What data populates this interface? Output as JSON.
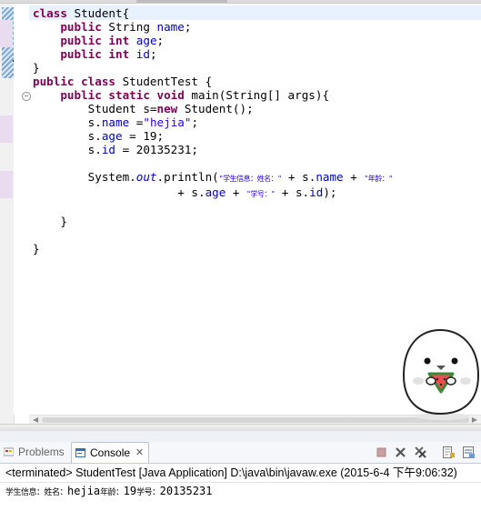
{
  "code": {
    "l1_kw": "class",
    "l1_rest": " Student{",
    "l2_kw": "public",
    "l2_type": " String ",
    "l2_field": "name",
    "l2_end": ";",
    "l3_kw": "public",
    "l3_kw2": " int",
    "l3_sp": " ",
    "l3_field": "age",
    "l3_end": ";",
    "l4_kw": "public",
    "l4_kw2": " int",
    "l4_sp": " ",
    "l4_field": "id",
    "l4_end": ";",
    "l5": "}",
    "l6_kw": "public class",
    "l6_rest": " StudentTest {",
    "l7_kw": "public static void",
    "l7_rest": " main(String[] args){",
    "l8_a": "Student s=",
    "l8_kw": "new",
    "l8_b": " Student();",
    "l9_a": "s.",
    "l9_field": "name",
    "l9_b": " =",
    "l9_str": "\"hejia\"",
    "l9_c": ";",
    "l10_a": "s.",
    "l10_field": "age",
    "l10_b": " = 19;",
    "l11_a": "s.",
    "l11_field": "id",
    "l11_b": " = 20135231;",
    "l13_a": "System.",
    "l13_out": "out",
    "l13_b": ".println(",
    "l13_s1": "\"学生信息：姓名：\"",
    "l13_c": " + s.",
    "l13_f1": "name",
    "l13_d": " + ",
    "l13_s2": "\"年龄：\"",
    "l14_a": " + s.",
    "l14_f1": "age",
    "l14_b": " + ",
    "l14_s1": "\"学号：\"",
    "l14_c": " + s.",
    "l14_f2": "id",
    "l14_d": ");",
    "l16": "}",
    "l18": "}"
  },
  "console": {
    "tab_problems": "Problems",
    "tab_console": "Console",
    "tab_close": "✕",
    "header": "<terminated> StudentTest [Java Application] D:\\java\\bin\\javaw.exe (2015-6-4 下午9:06:32)",
    "output_label1": "学生信息：姓名：",
    "output_name": "hejia",
    "output_label2": "年龄：",
    "output_age": "19",
    "output_label3": "学号：",
    "output_id": "20135231"
  },
  "icons": {
    "problems": "problems-icon",
    "console": "console-icon",
    "terminate": "terminate-icon",
    "remove_launch": "remove-launch-icon",
    "remove_all": "remove-all-terminated-icon",
    "scroll_lock": "scroll-lock-icon",
    "word_wrap": "word-wrap-icon"
  },
  "colors": {
    "keyword": "#7f0055",
    "field": "#0000c0",
    "string": "#2a00ff",
    "current_line": "#e8f2fe",
    "tab_border": "#b8c3d3"
  }
}
